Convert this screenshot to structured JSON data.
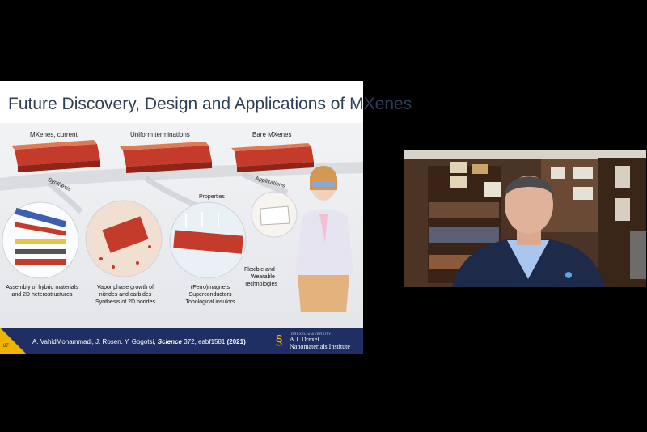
{
  "slide": {
    "title": "Future Discovery, Design and Applications of MXenes",
    "top_labels": {
      "current": "MXenes, current",
      "uniform": "Uniform terminations",
      "bare": "Bare MXenes"
    },
    "branch_labels": {
      "synthesis": "Synthesis",
      "properties": "Properties",
      "applications": "Applications"
    },
    "captions": {
      "assembly": [
        "Assembly of hybrid materials",
        "and 2D heterostructures"
      ],
      "vapor": [
        "Vapor phase growth of",
        "nitrides and carbides",
        "Synthesis of 2D borides"
      ],
      "ferro": [
        "(Ferro)magnets",
        "Superconductors",
        "Topological insulors"
      ],
      "flexible": [
        "Flexible and",
        "Wearable",
        "Technologies"
      ]
    },
    "slide_number": "87",
    "citation": {
      "authors": "A. VahidMohammadi, J. Rosen. Y. Gogotsi, ",
      "journal": "Science",
      "details": " 372, eabf1581 ",
      "year": "(2021)"
    },
    "logo": {
      "small": "DREXEL UNIVERSITY",
      "line1": "A.J. Drexel",
      "line2": "Nanomaterials Institute"
    }
  },
  "colors": {
    "footer": "#1f2f63",
    "accent": "#f0b400",
    "title": "#2d3e57"
  }
}
